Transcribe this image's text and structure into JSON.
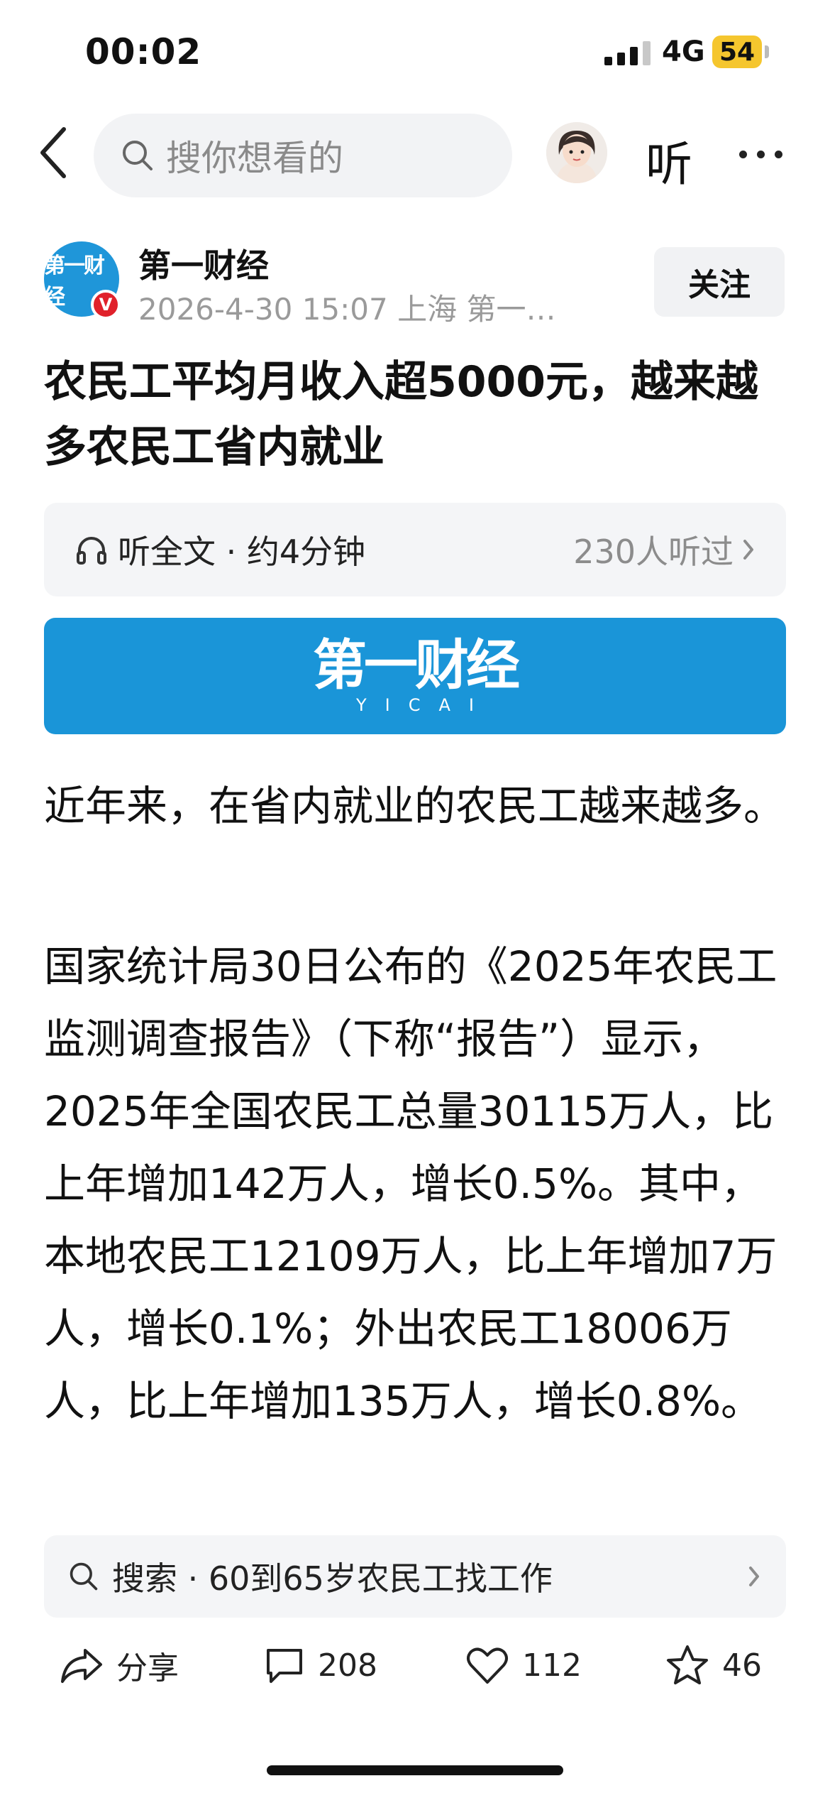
{
  "status_bar": {
    "time": "00:02",
    "network": "4G",
    "battery": "54"
  },
  "nav": {
    "search_placeholder": "搜你想看的",
    "listen_label": "听"
  },
  "author": {
    "logo_text": "第一财经",
    "verified_badge": "V",
    "name": "第一财经",
    "meta": "2026-4-30 15:07 上海 第一…",
    "follow_label": "关注"
  },
  "article": {
    "title": "农民工平均月收入超5000元，越来越多农民工省内就业",
    "listen_text": "听全文 · 约4分钟",
    "listen_count": "230人听过",
    "banner_logo": "第一财经",
    "banner_sub": "YICAI",
    "paragraphs": [
      "近年来，在省内就业的农民工越来越多。",
      "国家统计局30日公布的《2025年农民工监测调查报告》（下称“报告”）显示，2025年全国农民工总量30115万人，比上年增加142万人，增长0.5%。其中，本地农民工12109万人，比上年增加7万人，增长0.1%；外出农民工18006万人，比上年增加135万人，增长0.8%。"
    ]
  },
  "bottom": {
    "suggest_search": "搜索 · 60到65岁农民工找工作",
    "share_label": "分享",
    "comments": "208",
    "likes": "112",
    "favorites": "46"
  },
  "colors": {
    "brand_blue": "#1a95d8",
    "badge_red": "#e0212b",
    "battery_yellow": "#f5c62e"
  },
  "icons": [
    "back-icon",
    "search-icon",
    "avatar",
    "more-icon",
    "headphones-icon",
    "chevron-right-icon",
    "share-icon",
    "comment-icon",
    "like-icon",
    "star-icon"
  ]
}
